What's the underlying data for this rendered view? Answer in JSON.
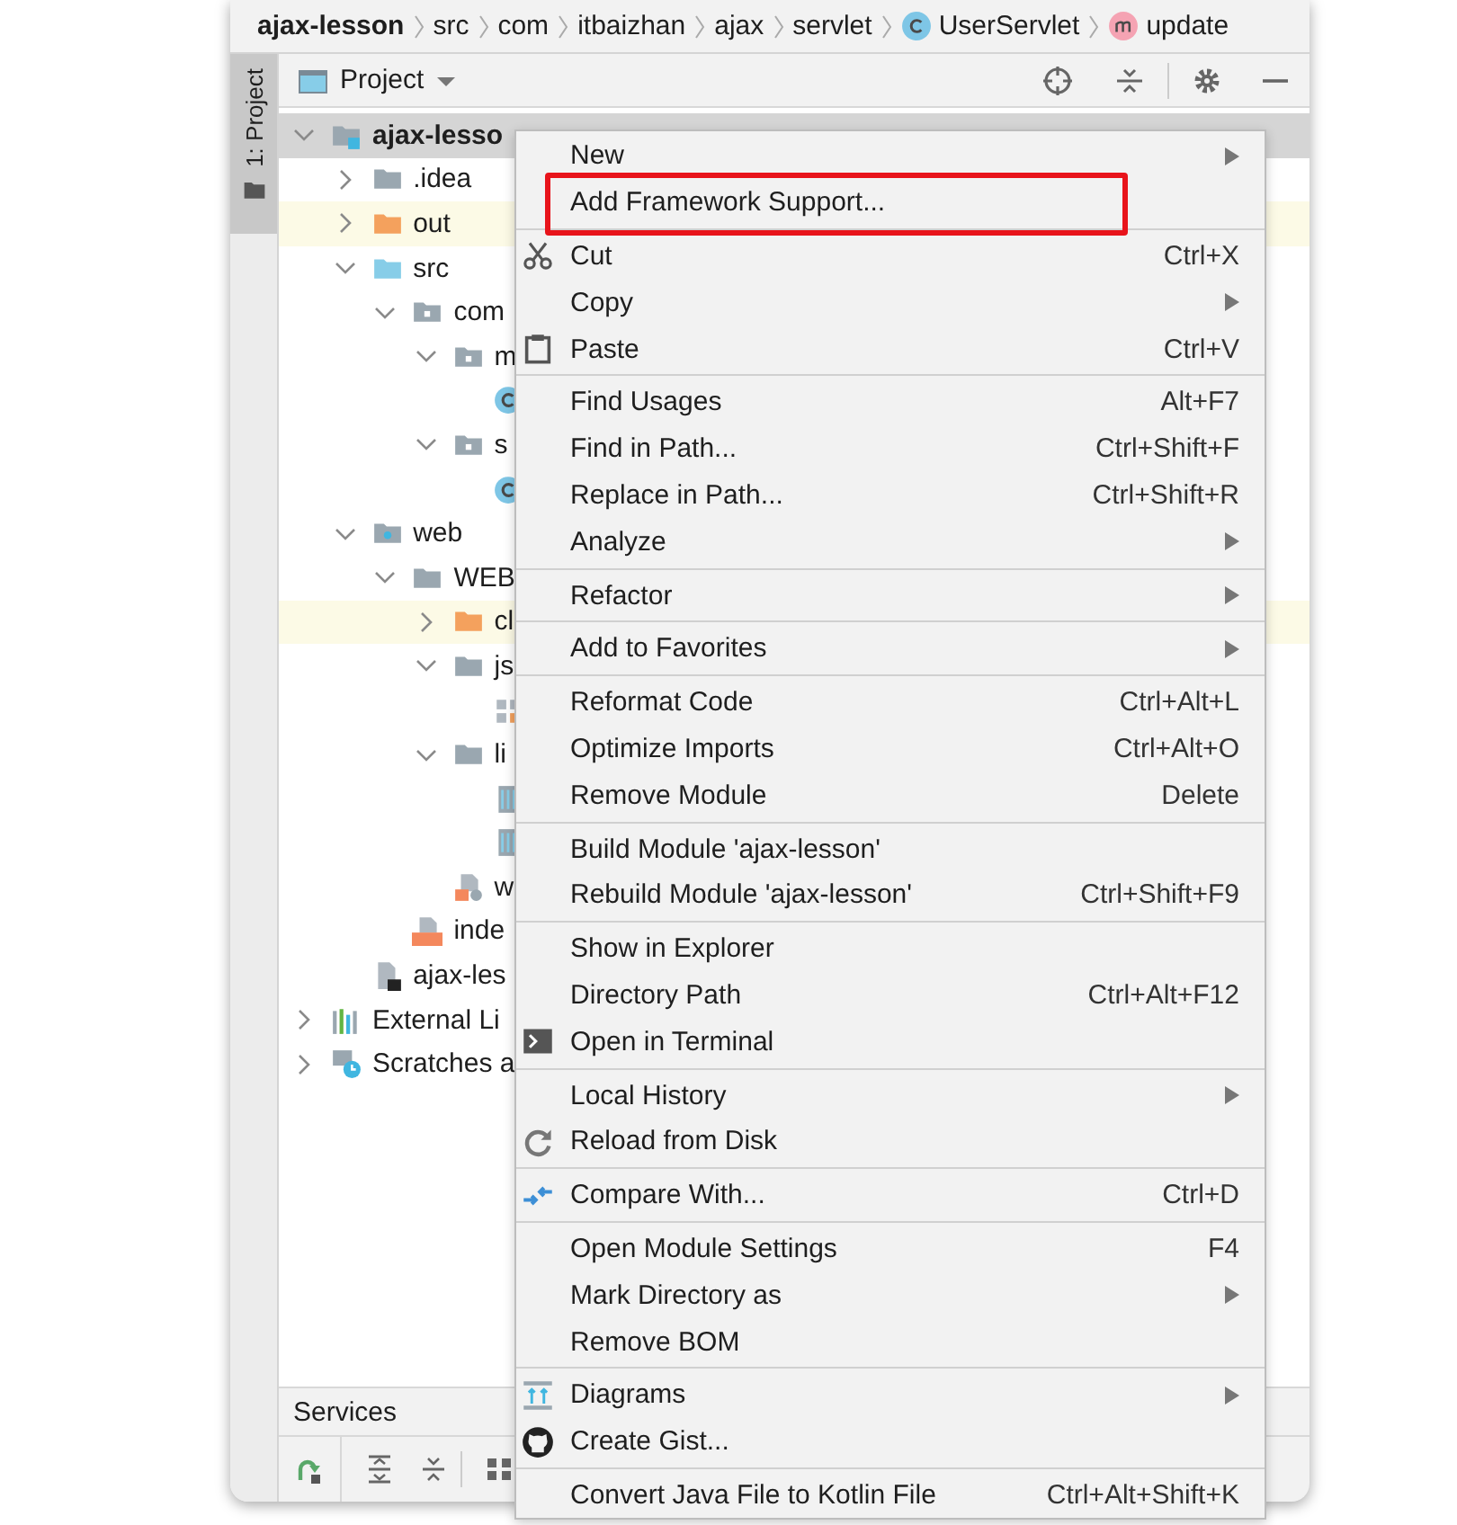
{
  "breadcrumb": [
    {
      "label": "ajax-lesson",
      "kind": "module"
    },
    {
      "label": "src",
      "kind": "plain"
    },
    {
      "label": "com",
      "kind": "plain"
    },
    {
      "label": "itbaizhan",
      "kind": "plain"
    },
    {
      "label": "ajax",
      "kind": "plain"
    },
    {
      "label": "servlet",
      "kind": "plain"
    },
    {
      "label": "UserServlet",
      "kind": "class"
    },
    {
      "label": "update",
      "kind": "method"
    }
  ],
  "side_tab": {
    "label": "1: Project",
    "selected": true
  },
  "project_panel": {
    "title": "Project",
    "tree": [
      {
        "label": "ajax-lesso",
        "kind": "module",
        "expanded": true,
        "selected": true,
        "highlighted": false,
        "children": [
          {
            "label": ".idea",
            "kind": "folder",
            "expanded": false,
            "selected": false,
            "highlighted": false
          },
          {
            "label": "out",
            "kind": "excluded-folder",
            "expanded": false,
            "selected": false,
            "highlighted": true
          },
          {
            "label": "src",
            "kind": "source-folder",
            "expanded": true,
            "selected": false,
            "highlighted": false,
            "children": [
              {
                "label": "com",
                "kind": "package",
                "expanded": true,
                "selected": false,
                "highlighted": false,
                "children": [
                  {
                    "label": "m",
                    "kind": "package",
                    "expanded": true,
                    "selected": false,
                    "highlighted": false,
                    "children": [
                      {
                        "kind": "class",
                        "selected": false,
                        "highlighted": false
                      }
                    ]
                  },
                  {
                    "label": "s",
                    "kind": "package",
                    "expanded": true,
                    "selected": false,
                    "highlighted": false,
                    "children": [
                      {
                        "kind": "class",
                        "selected": false,
                        "highlighted": false
                      }
                    ]
                  }
                ]
              }
            ]
          },
          {
            "label": "web",
            "kind": "web-folder",
            "expanded": true,
            "selected": false,
            "highlighted": false,
            "children": [
              {
                "label": "WEB",
                "kind": "folder",
                "expanded": true,
                "selected": false,
                "highlighted": false,
                "children": [
                  {
                    "label": "cl",
                    "kind": "excluded-folder",
                    "expanded": false,
                    "selected": false,
                    "highlighted": true
                  },
                  {
                    "label": "js",
                    "kind": "folder",
                    "expanded": true,
                    "selected": false,
                    "highlighted": false,
                    "children": [
                      {
                        "kind": "binary-file",
                        "selected": false,
                        "highlighted": false
                      }
                    ]
                  },
                  {
                    "label": "li",
                    "kind": "folder",
                    "expanded": true,
                    "selected": false,
                    "highlighted": false,
                    "children": [
                      {
                        "kind": "jar",
                        "selected": false,
                        "highlighted": false
                      },
                      {
                        "kind": "jar",
                        "selected": false,
                        "highlighted": false
                      }
                    ]
                  },
                  {
                    "label": "w",
                    "kind": "xml-file",
                    "selected": false,
                    "highlighted": false
                  }
                ]
              },
              {
                "label": "inde",
                "kind": "jsp-file",
                "selected": false,
                "highlighted": false
              }
            ]
          },
          {
            "label": "ajax-les",
            "kind": "iml-file",
            "selected": false,
            "highlighted": false
          }
        ]
      },
      {
        "label": "External Li",
        "kind": "libraries",
        "expanded": false,
        "selected": false,
        "highlighted": false
      },
      {
        "label": "Scratches a",
        "kind": "scratches",
        "expanded": false,
        "selected": false,
        "highlighted": false
      }
    ]
  },
  "context_menu": {
    "groups": [
      {
        "items": [
          {
            "label": "New",
            "submenu": true
          },
          {
            "label": "Add Framework Support...",
            "submenu": false,
            "boxed": true
          }
        ]
      },
      {
        "items": [
          {
            "label": "Cut",
            "shortcut": "Ctrl+X",
            "submenu": false,
            "kind": "scissors"
          },
          {
            "label": "Copy",
            "submenu": true
          },
          {
            "label": "Paste",
            "shortcut": "Ctrl+V",
            "submenu": false,
            "kind": "clipboard"
          }
        ]
      },
      {
        "items": [
          {
            "label": "Find Usages",
            "shortcut": "Alt+F7",
            "submenu": false
          },
          {
            "label": "Find in Path...",
            "shortcut": "Ctrl+Shift+F",
            "submenu": false
          },
          {
            "label": "Replace in Path...",
            "shortcut": "Ctrl+Shift+R",
            "submenu": false
          },
          {
            "label": "Analyze",
            "submenu": true
          }
        ]
      },
      {
        "items": [
          {
            "label": "Refactor",
            "submenu": true
          }
        ]
      },
      {
        "items": [
          {
            "label": "Add to Favorites",
            "submenu": true
          }
        ]
      },
      {
        "items": [
          {
            "label": "Reformat Code",
            "shortcut": "Ctrl+Alt+L",
            "submenu": false
          },
          {
            "label": "Optimize Imports",
            "shortcut": "Ctrl+Alt+O",
            "submenu": false
          },
          {
            "label": "Remove Module",
            "shortcut": "Delete",
            "submenu": false
          }
        ]
      },
      {
        "items": [
          {
            "label": "Build Module 'ajax-lesson'",
            "submenu": false
          },
          {
            "label": "Rebuild Module 'ajax-lesson'",
            "shortcut": "Ctrl+Shift+F9",
            "submenu": false
          }
        ]
      },
      {
        "items": [
          {
            "label": "Show in Explorer",
            "submenu": false
          },
          {
            "label": "Directory Path",
            "shortcut": "Ctrl+Alt+F12",
            "submenu": false
          },
          {
            "label": "Open in Terminal",
            "submenu": false,
            "kind": "terminal"
          }
        ]
      },
      {
        "items": [
          {
            "label": "Local History",
            "submenu": true
          },
          {
            "label": "Reload from Disk",
            "submenu": false,
            "kind": "reload"
          }
        ]
      },
      {
        "items": [
          {
            "label": "Compare With...",
            "shortcut": "Ctrl+D",
            "submenu": false,
            "kind": "compare"
          }
        ]
      },
      {
        "items": [
          {
            "label": "Open Module Settings",
            "shortcut": "F4",
            "submenu": false
          },
          {
            "label": "Mark Directory as",
            "submenu": true
          },
          {
            "label": "Remove BOM",
            "submenu": false
          }
        ]
      },
      {
        "items": [
          {
            "label": "Diagrams",
            "submenu": true,
            "kind": "diagram"
          },
          {
            "label": "Create Gist...",
            "submenu": false,
            "kind": "gist"
          }
        ]
      },
      {
        "items": [
          {
            "label": "Convert Java File to Kotlin File",
            "shortcut": "Ctrl+Alt+Shift+K",
            "submenu": false
          }
        ]
      }
    ]
  },
  "services_panel": {
    "title": "Services"
  }
}
